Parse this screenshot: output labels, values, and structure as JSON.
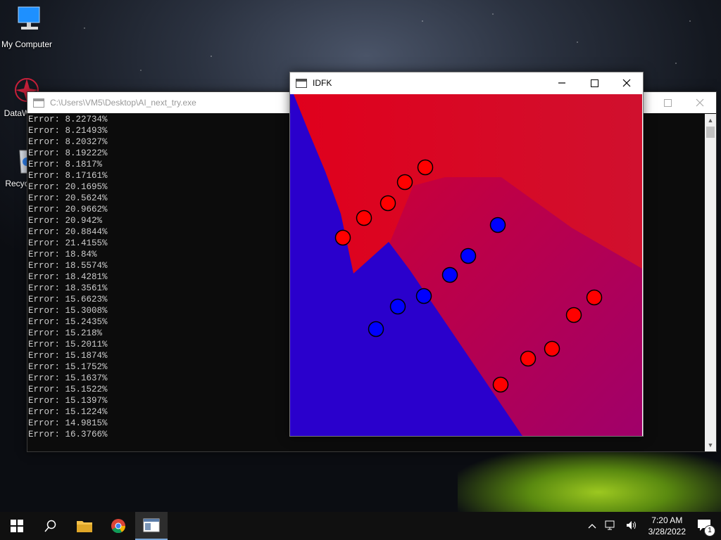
{
  "desktop": {
    "icons": [
      {
        "label": "My Computer"
      },
      {
        "label": "DataW"
      },
      {
        "label": "Recyc"
      }
    ]
  },
  "console": {
    "title": "C:\\Users\\VM5\\Desktop\\AI_next_try.exe",
    "lines": [
      "Error: 8.22734%",
      "Error: 8.21493%",
      "Error: 8.20327%",
      "Error: 8.19222%",
      "Error: 8.1817%",
      "Error: 8.17161%",
      "Error: 20.1695%",
      "Error: 20.5624%",
      "Error: 20.9662%",
      "Error: 20.942%",
      "Error: 20.8844%",
      "Error: 21.4155%",
      "Error: 18.84%",
      "Error: 18.5574%",
      "Error: 18.4281%",
      "Error: 18.3561%",
      "Error: 15.6623%",
      "Error: 15.3008%",
      "Error: 15.2435%",
      "Error: 15.218%",
      "Error: 15.2011%",
      "Error: 15.1874%",
      "Error: 15.1752%",
      "Error: 15.1637%",
      "Error: 15.1522%",
      "Error: 15.1397%",
      "Error: 15.1224%",
      "Error: 14.9815%",
      "Error: 16.3766%"
    ]
  },
  "plot_window": {
    "title": "IDFK",
    "colors": {
      "red": "#e0001e",
      "blue": "#2800d0",
      "magenta": "#a8005e"
    },
    "points": [
      {
        "cls": "red"
      },
      {
        "cls": "red"
      },
      {
        "cls": "red"
      },
      {
        "cls": "red"
      },
      {
        "cls": "red"
      },
      {
        "cls": "blue"
      },
      {
        "cls": "blue"
      },
      {
        "cls": "blue"
      },
      {
        "cls": "blue"
      },
      {
        "cls": "blue"
      },
      {
        "cls": "blue"
      },
      {
        "cls": "red"
      },
      {
        "cls": "red"
      },
      {
        "cls": "red"
      },
      {
        "cls": "red"
      },
      {
        "cls": "red"
      }
    ]
  },
  "taskbar": {
    "items": [
      "start-icon",
      "search-icon",
      "file-explorer-icon",
      "chrome-icon",
      "console-app-icon"
    ],
    "time": "7:20 AM",
    "date": "3/28/2022",
    "notification_count": "1"
  }
}
